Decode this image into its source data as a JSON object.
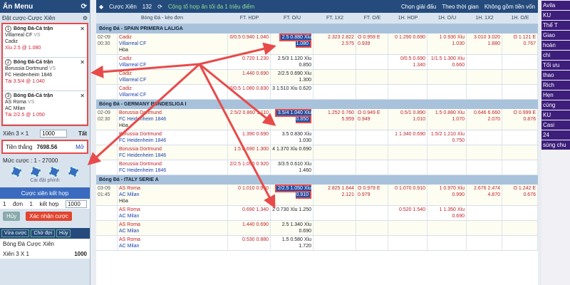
{
  "left": {
    "title": "Ẩn Menu",
    "sub": "Đặt cược-Cược Xiên",
    "bets": [
      {
        "n": "1",
        "league": "Bóng Đá-Cả trận",
        "home": "Villarreal CF",
        "vs": "VS",
        "away": "Cadiz",
        "odd": "Xỉu 2.5 @ 1.080"
      },
      {
        "n": "2",
        "league": "Bóng Đá-Cả trận",
        "home": "Borussia Dortmund",
        "vs": "VS",
        "away": "FC Heidenheim 1846",
        "odd": "Tài 3.5/4 @ 1.040"
      },
      {
        "n": "3",
        "league": "Bóng Đá-Cả trận",
        "home": "AS Roma",
        "vs": "VS",
        "away": "AC Milan",
        "odd": "Tài 2/2.5 @ 1.050"
      }
    ],
    "xien_label": "Xiên 3 × 1",
    "stake": "1000",
    "tat": "Tất",
    "win_label": "Tiền thắng",
    "win_value": "7698.56",
    "mo": "Mở",
    "muc_cuoc": "Mức cược : 1 - 27000",
    "chip_setting": "Cài đặt phỉnh",
    "combo_header": "Cược xiên kết hợp",
    "combo_row": {
      "a": "1",
      "b": "đơn",
      "c": "1",
      "d": "kết hợp",
      "e": "1000"
    },
    "huy": "Hủy",
    "xac_nhan": "Xác nhận cược",
    "tabs": [
      "Vừa cược",
      "Chờ đợi",
      "Hủy"
    ],
    "recent1": "Bóng Đá Cược Xiên",
    "recent2": "Xiên 3 X 1",
    "recent2v": "1000"
  },
  "main": {
    "title": "Cược Xiên",
    "count": "132",
    "notice": "Cộng tổ hợp ăn tối đa 1 triệu điểm",
    "filters": [
      "Chọn giải đấu",
      "Theo thời gian",
      "Không gồm tiền vốn"
    ],
    "headers": [
      "Bóng Đá - kèo đơn",
      "FT. HDP",
      "FT. O/U",
      "FT. 1X2",
      "FT. O/E",
      "1H. HDP",
      "1H. O/U",
      "1H. 1X2",
      "1H. O/E"
    ],
    "leagues": [
      {
        "name": "Bóng Đá - SPAIN PRIMERA LALIGA",
        "rows": [
          {
            "time": "02-09 00:30",
            "teams": [
              "Cadiz",
              "Villarreal CF",
              "Hòa"
            ],
            "hdp": "0/0.5  0.940 1.040",
            "ou": "2.5  0.880 Xỉu 1.080",
            "x": "2.323 2.822 2.575",
            "oe": "O 0.959 E 0.939",
            "h1": "0 1.290 0.690",
            "h1ou": "1 0.930 Xỉu 1.030",
            "h1x": "3.010 3.020 1.880",
            "h1oe": "O 1.121 E 0.767"
          },
          {
            "time": "",
            "teams": [
              "Cadiz",
              "Villarreal CF",
              ""
            ],
            "hdp": "0.720 1.230",
            "ou": "2.5/3 1.120 Xỉu 0.850",
            "x": "",
            "oe": "",
            "h1": "0/0.5 0.690 1.340",
            "h1ou": "1/1.5 1.300 Xỉu 0.660",
            "h1x": "",
            "h1oe": ""
          },
          {
            "time": "",
            "teams": [
              "Cadiz",
              "Villarreal CF",
              ""
            ],
            "hdp": "1.440 0.690",
            "ou": "2/2.5 0.690 Xỉu 1.300",
            "x": "",
            "oe": "",
            "h1": "",
            "h1ou": "",
            "h1x": "",
            "h1oe": ""
          },
          {
            "time": "",
            "teams": [
              "Cadiz",
              "Villarreal CF",
              ""
            ],
            "hdp": "0/0.5 1.080 0.830",
            "ou": "3 1.510 Xỉu 0.620",
            "x": "",
            "oe": "",
            "h1": "",
            "h1ou": "",
            "h1x": "",
            "h1oe": ""
          }
        ]
      },
      {
        "name": "Bóng Đá - GERMANY BUNDESLIGA I",
        "rows": [
          {
            "time": "02-09 02:30",
            "teams": [
              "Borussia Dortmund",
              "FC Heidenheim 1846",
              "Hòa"
            ],
            "hdp": "2.5/2 0.860 1.110",
            "ou": "3.5/4 1.040 Xỉu 0.850",
            "x": "1.252 0.760 5.959",
            "oe": "O 0.949 E 0.949",
            "h1": "0.5/1 0.890 1.010",
            "h1ou": "1.5 0.880 Xỉu 1.070",
            "h1x": "0.646 6.660 2.070",
            "h1oe": "O 0.999 E 0.876"
          },
          {
            "time": "",
            "teams": [
              "Borussia Dortmund",
              "FC Heidenheim 1846",
              ""
            ],
            "hdp": "1.390 0.690",
            "ou": "3.5 0.830 Xỉu 1.030",
            "x": "",
            "oe": "",
            "h1": "1 1.340 0.690",
            "h1ou": "1.5/2 1.210 Xỉu 0.750",
            "h1x": "",
            "h1oe": ""
          },
          {
            "time": "",
            "teams": [
              "Borussia Dortmund",
              "FC Heidenheim 1846",
              ""
            ],
            "hdp": "1.5 0.690 1.300",
            "ou": "4 1.370 Xỉu 0.690",
            "x": "",
            "oe": "",
            "h1": "",
            "h1ou": "",
            "h1x": "",
            "h1oe": ""
          },
          {
            "time": "",
            "teams": [
              "Borussia Dortmund",
              "FC Heidenheim 1846",
              ""
            ],
            "hdp": "2/2.5 1.090 0.920",
            "ou": "3/3.5 0.610 Xỉu 1.460",
            "x": "",
            "oe": "",
            "h1": "",
            "h1ou": "",
            "h1x": "",
            "h1oe": ""
          }
        ]
      },
      {
        "name": "Bóng Đá - ITALY SERIE A",
        "rows": [
          {
            "time": "03-09 01:45",
            "teams": [
              "AS Roma",
              "AC Milan",
              "Hòa"
            ],
            "hdp": "0 1.010 0.950",
            "ou": "2/2.5 1.050 Xỉu 0.910",
            "x": "2.825 1.644 2.121",
            "oe": "O 0.979 E 0.979",
            "h1": "0 1.070 0.910",
            "h1ou": "1 0.970 Xỉu 0.990",
            "h1x": "2.676 2.474 4.870",
            "h1oe": "O 1.242 E 0.676"
          },
          {
            "time": "",
            "teams": [
              "AS Roma",
              "AC Milan",
              ""
            ],
            "hdp": "0.690 1.340",
            "ou": "2 0.730 Xỉu 1.250",
            "x": "",
            "oe": "",
            "h1": "0.520 1.540",
            "h1ou": "1 1.350 Xỉu 0.690",
            "h1x": "",
            "h1oe": ""
          },
          {
            "time": "",
            "teams": [
              "AS Roma",
              "AC Milan",
              ""
            ],
            "hdp": "1.440 0.690",
            "ou": "2.5 1.340 Xỉu 0.690",
            "x": "",
            "oe": "",
            "h1": "",
            "h1ou": "",
            "h1x": "",
            "h1oe": ""
          },
          {
            "time": "",
            "teams": [
              "AS Roma",
              "AC Milan",
              ""
            ],
            "hdp": "0.530 0.880",
            "ou": "1.5 0.580 Xỉu 1.720",
            "x": "",
            "oe": "",
            "h1": "",
            "h1ou": "",
            "h1x": "",
            "h1oe": ""
          }
        ]
      }
    ]
  },
  "ad": {
    "tags": [
      "Avila",
      "KU",
      "Thể T",
      "Giao",
      "hoàn",
      "chi",
      "Tối ưu",
      "thao",
      "Rich",
      "Hẹn",
      "cùng",
      "KU",
      "Casi",
      "24",
      "sùng chu"
    ]
  }
}
